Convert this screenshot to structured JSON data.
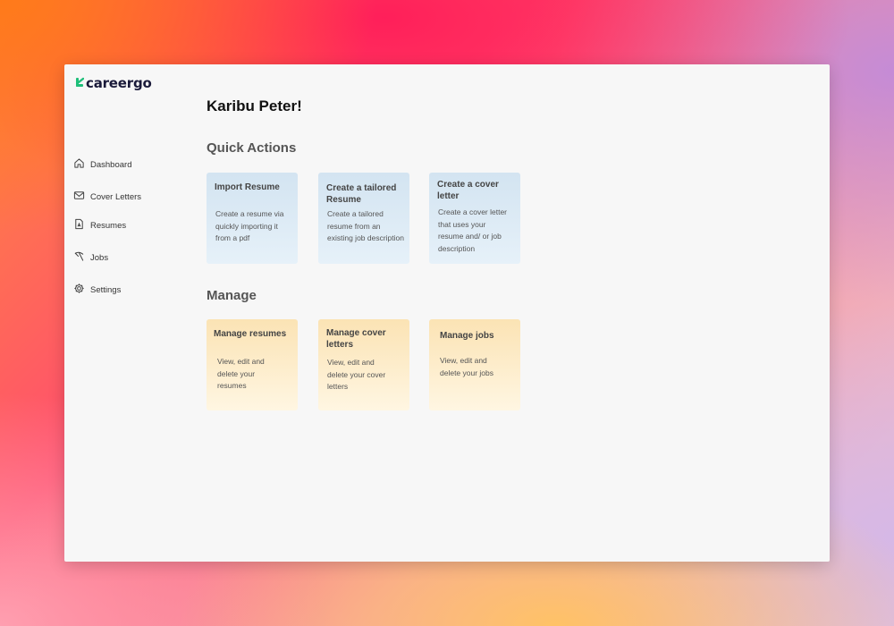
{
  "app": {
    "name": "careergo",
    "brand_color": "#1fbf7a",
    "text_color": "#1a1a3a"
  },
  "sidebar": {
    "items": [
      {
        "label": "Dashboard",
        "icon": "home-icon"
      },
      {
        "label": "Cover Letters",
        "icon": "mail-icon"
      },
      {
        "label": "Resumes",
        "icon": "document-icon"
      },
      {
        "label": "Jobs",
        "icon": "pickaxe-icon"
      },
      {
        "label": "Settings",
        "icon": "gear-icon"
      }
    ]
  },
  "main": {
    "greeting": "Karibu Peter!",
    "quick_actions": {
      "title": "Quick Actions",
      "cards": [
        {
          "title": "Import Resume",
          "description": "Create a resume via quickly importing it from a pdf"
        },
        {
          "title": "Create a tailored Resume",
          "description": "Create a tailored resume from an existing job description"
        },
        {
          "title": "Create a cover letter",
          "description": "Create a cover letter that uses your resume and/ or job description"
        }
      ]
    },
    "manage": {
      "title": "Manage",
      "cards": [
        {
          "title": "Manage resumes",
          "description": "View, edit and delete your resumes"
        },
        {
          "title": "Manage cover letters",
          "description": "View, edit and delete your cover letters"
        },
        {
          "title": "Manage jobs",
          "description": "View, edit and delete your jobs"
        }
      ]
    }
  }
}
